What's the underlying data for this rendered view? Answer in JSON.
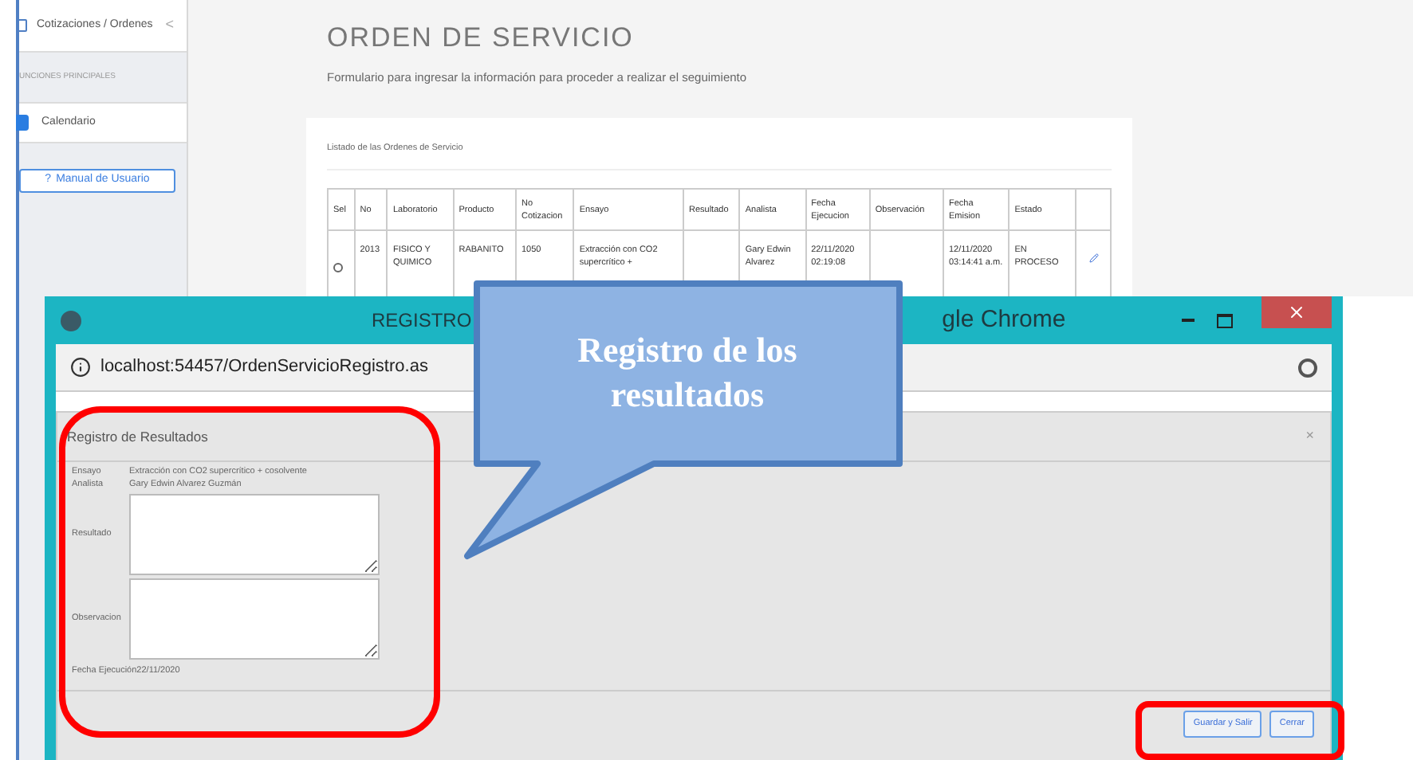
{
  "sidebar": {
    "items": [
      {
        "kind": "nav",
        "label": "Cotizaciones / Ordenes",
        "chevron": "<"
      },
      {
        "kind": "section",
        "label": "UNCIONES PRINCIPALES"
      },
      {
        "kind": "nav-active",
        "label": "Calendario"
      }
    ],
    "help_button": {
      "icon": "?",
      "label": "Manual de Usuario"
    }
  },
  "page": {
    "title": "ORDEN DE SERVICIO",
    "subtitle": "Formulario para ingresar la información para proceder a realizar el seguimiento"
  },
  "table": {
    "caption": "Listado de las Ordenes de Servicio",
    "columns": [
      "Sel",
      "No",
      "Laboratorio",
      "Producto",
      "No Cotizacion",
      "Ensayo",
      "Resultado",
      "Analista",
      "Fecha Ejecucion",
      "Observación",
      "Fecha Emision",
      "Estado"
    ],
    "rows": [
      {
        "selected": false,
        "cells": [
          "",
          "2013",
          "FISICO Y QUIMICO",
          "RABANITO",
          "1050",
          "Extracción con CO2 supercrítico +",
          "",
          "Gary Edwin Alvarez",
          "22/11/2020 02:19:08",
          "",
          "12/11/2020 03:14:41 a.m.",
          "EN PROCESO"
        ]
      }
    ]
  },
  "browser_window": {
    "title_left": "REGISTRO",
    "title_right": "gle Chrome",
    "address": "localhost:54457/OrdenServicioRegistro.as"
  },
  "modal": {
    "title": "Registro de Resultados",
    "close": "×",
    "fields": [
      {
        "kind": "text",
        "label": "Ensayo",
        "value": "Extracción con CO2 supercrítico + cosolvente"
      },
      {
        "kind": "text",
        "label": "Analista",
        "value": "Gary Edwin Alvarez Guzmán"
      },
      {
        "kind": "textarea",
        "label": "Resultado"
      },
      {
        "kind": "textarea",
        "label": "Observacion"
      },
      {
        "kind": "inline",
        "label": "Fecha Ejecución",
        "value": "22/11/2020"
      }
    ],
    "buttons": [
      "Guardar y Salir",
      "Cerrar"
    ]
  },
  "callout": {
    "text": "Registro de los resultados"
  }
}
